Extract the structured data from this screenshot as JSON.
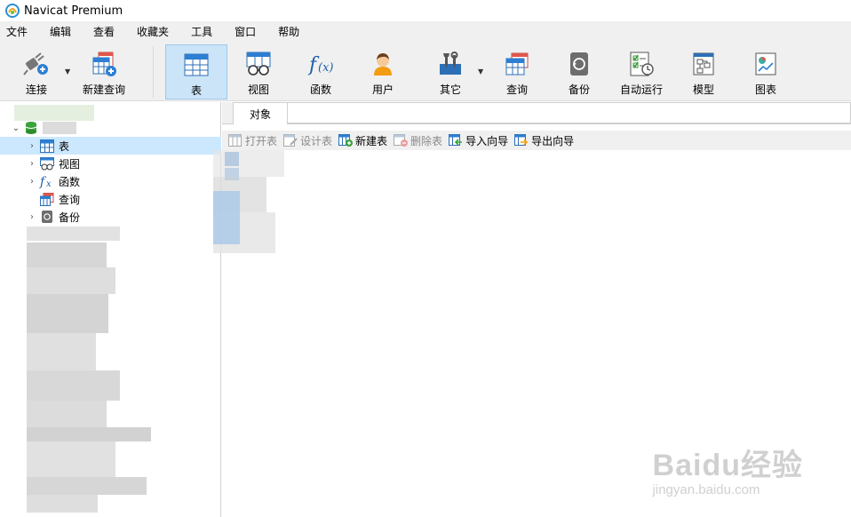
{
  "window": {
    "title": "Navicat Premium"
  },
  "menu": [
    "文件",
    "编辑",
    "查看",
    "收藏夹",
    "工具",
    "窗口",
    "帮助"
  ],
  "toolbar": {
    "items": [
      {
        "label": "连接",
        "icon": "plug-icon"
      },
      {
        "label": "新建查询",
        "icon": "new-query-icon"
      },
      {
        "label": "表",
        "icon": "table-icon",
        "active": true
      },
      {
        "label": "视图",
        "icon": "view-icon"
      },
      {
        "label": "函数",
        "icon": "function-icon"
      },
      {
        "label": "用户",
        "icon": "user-icon"
      },
      {
        "label": "其它",
        "icon": "tools-icon"
      },
      {
        "label": "查询",
        "icon": "query-icon"
      },
      {
        "label": "备份",
        "icon": "backup-icon"
      },
      {
        "label": "自动运行",
        "icon": "schedule-icon"
      },
      {
        "label": "模型",
        "icon": "model-icon"
      },
      {
        "label": "图表",
        "icon": "chart-icon"
      }
    ]
  },
  "tree": {
    "items": [
      {
        "label": "表",
        "icon": "table-icon",
        "selected": true
      },
      {
        "label": "视图",
        "icon": "view-icon"
      },
      {
        "label": "函数",
        "icon": "function-icon"
      },
      {
        "label": "查询",
        "icon": "query-icon"
      },
      {
        "label": "备份",
        "icon": "backup-icon"
      }
    ]
  },
  "object_tab": {
    "label": "对象"
  },
  "object_toolbar": {
    "open": "打开表",
    "design": "设计表",
    "new": "新建表",
    "delete": "删除表",
    "import": "导入向导",
    "export": "导出向导"
  },
  "watermark": {
    "main": "Baidu经验",
    "sub": "jingyan.baidu.com"
  },
  "colors": {
    "accent": "#0078d7",
    "selected": "#cce8ff",
    "active_tool": "#cce4f7"
  }
}
